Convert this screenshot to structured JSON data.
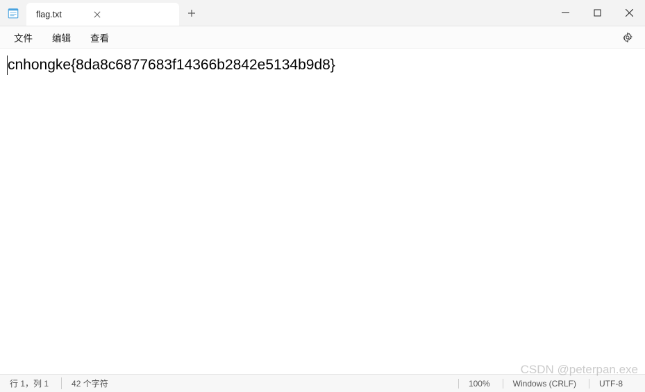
{
  "titlebar": {
    "tab_title": "flag.txt"
  },
  "menu": {
    "file": "文件",
    "edit": "编辑",
    "view": "查看"
  },
  "content": "cnhongke{8da8c6877683f14366b2842e5134b9d8}",
  "status": {
    "position": "行 1，列 1",
    "chars": "42 个字符",
    "zoom": "100%",
    "line_ending": "Windows (CRLF)",
    "encoding": "UTF-8"
  },
  "watermark": "CSDN @peterpan.exe"
}
